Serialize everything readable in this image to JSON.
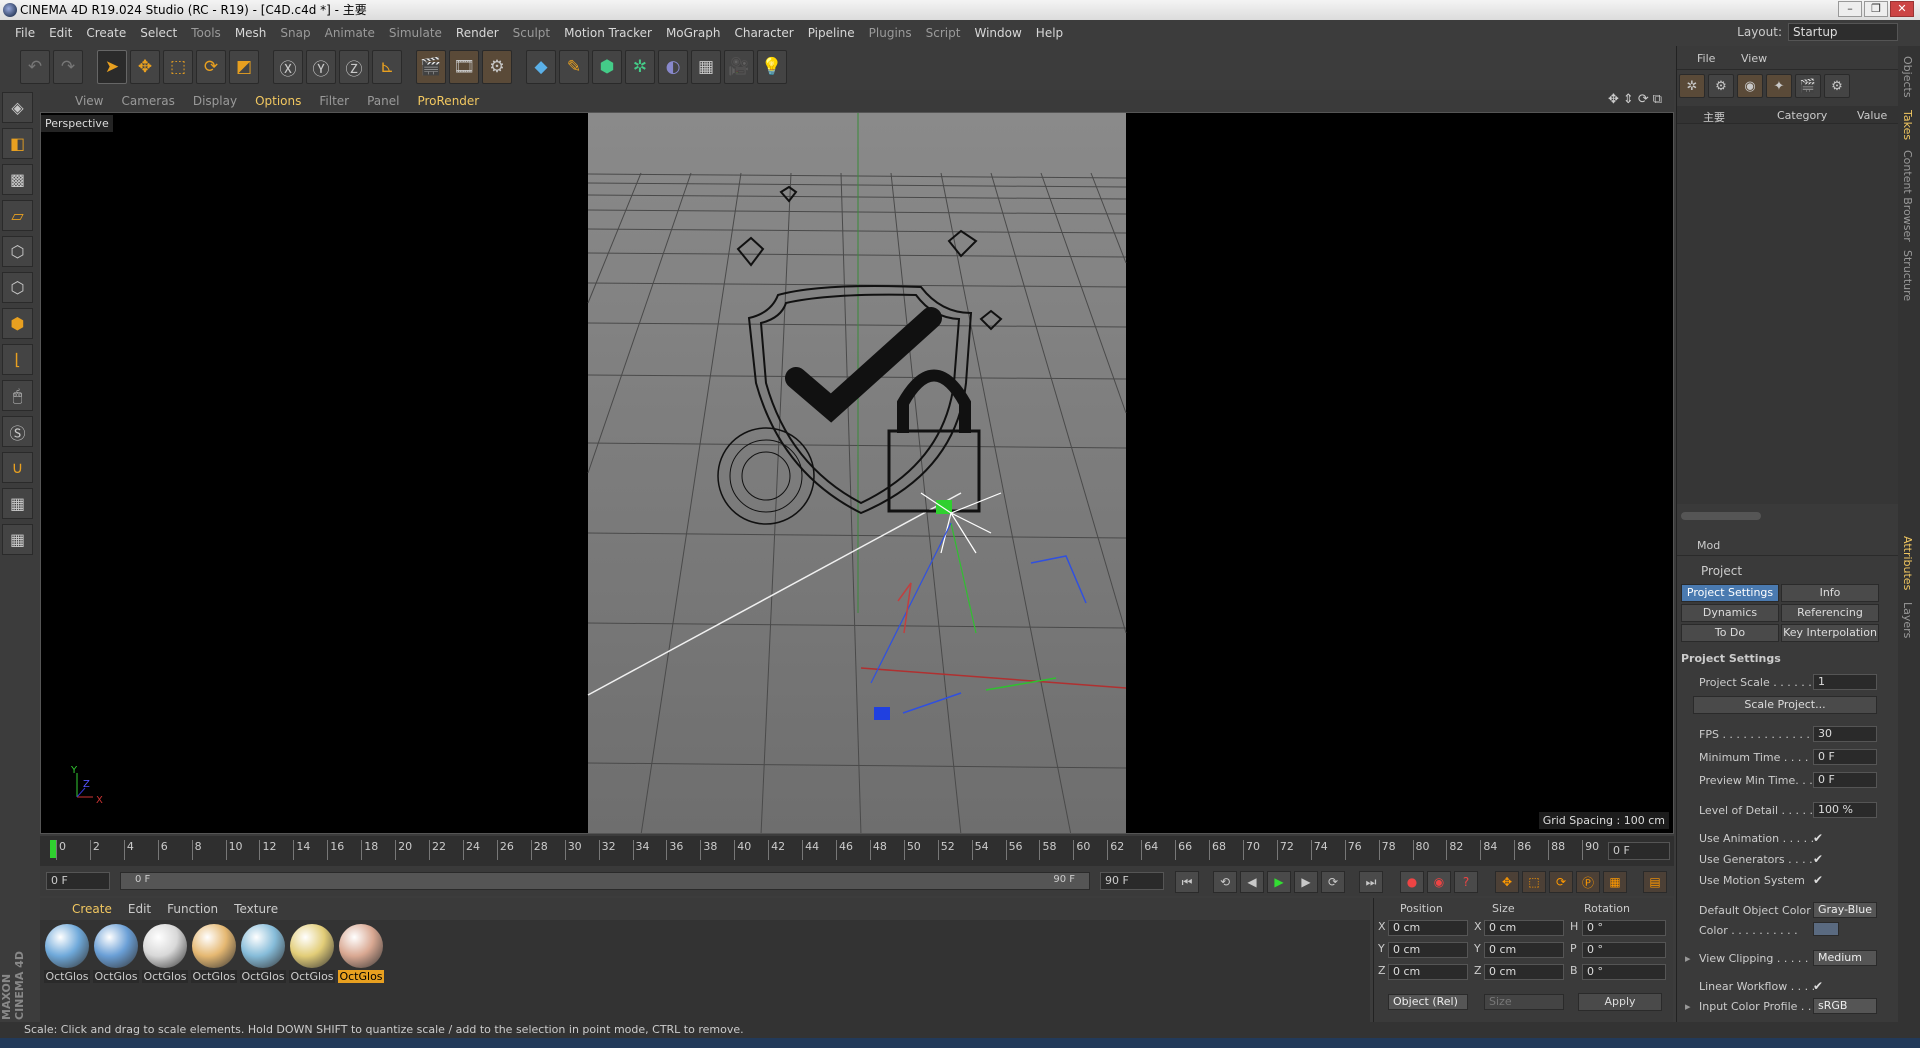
{
  "window": {
    "title": "CINEMA 4D R19.024 Studio (RC - R19) - [C4D.c4d *] - 主要"
  },
  "menu": [
    "File",
    "Edit",
    "Create",
    "Select",
    "Tools",
    "Mesh",
    "Snap",
    "Animate",
    "Simulate",
    "Render",
    "Sculpt",
    "Motion Tracker",
    "MoGraph",
    "Character",
    "Pipeline",
    "Plugins",
    "Script",
    "Window",
    "Help"
  ],
  "layout": {
    "label": "Layout:",
    "value": "Startup"
  },
  "viewport": {
    "menu": [
      "View",
      "Cameras",
      "Display",
      "Options",
      "Filter",
      "Panel",
      "ProRender"
    ],
    "active_menu": "Options",
    "label": "Perspective",
    "grid_spacing": "Grid Spacing : 100 cm"
  },
  "timeline": {
    "ticks": [
      "0",
      "2",
      "4",
      "6",
      "8",
      "10",
      "12",
      "14",
      "16",
      "18",
      "20",
      "22",
      "24",
      "26",
      "28",
      "30",
      "32",
      "34",
      "36",
      "38",
      "40",
      "42",
      "44",
      "46",
      "48",
      "50",
      "52",
      "54",
      "56",
      "58",
      "60",
      "62",
      "64",
      "66",
      "68",
      "70",
      "72",
      "74",
      "76",
      "78",
      "80",
      "82",
      "84",
      "86",
      "88",
      "90"
    ],
    "current_frame": "0 F"
  },
  "controls": {
    "start": "0 F",
    "slider_left": "0 F",
    "slider_right": "90 F",
    "end": "90 F"
  },
  "materials": {
    "menu": [
      "Create",
      "Edit",
      "Function",
      "Texture"
    ],
    "active_menu": "Create",
    "items": [
      {
        "name": "OctGlos",
        "color": "#6fa9da"
      },
      {
        "name": "OctGlos",
        "color": "#6a9fd6"
      },
      {
        "name": "OctGlos",
        "color": "#d8d8d8"
      },
      {
        "name": "OctGlos",
        "color": "#e5b872"
      },
      {
        "name": "OctGlos",
        "color": "#86bcd9"
      },
      {
        "name": "OctGlos",
        "color": "#e2cd78"
      },
      {
        "name": "OctGlos",
        "color": "#d9a892"
      }
    ],
    "selected_index": 6
  },
  "coords": {
    "headers": {
      "position": "Position",
      "size": "Size",
      "rotation": "Rotation"
    },
    "rows": [
      {
        "axis": "X",
        "pos": "0 cm",
        "saxis": "X",
        "size": "0 cm",
        "raxis": "H",
        "rot": "0 °"
      },
      {
        "axis": "Y",
        "pos": "0 cm",
        "saxis": "Y",
        "size": "0 cm",
        "raxis": "P",
        "rot": "0 °"
      },
      {
        "axis": "Z",
        "pos": "0 cm",
        "saxis": "Z",
        "size": "0 cm",
        "raxis": "B",
        "rot": "0 °"
      }
    ],
    "mode": "Object (Rel)",
    "size_mode": "Size",
    "apply": "Apply"
  },
  "status": "Scale: Click and drag to scale elements. Hold DOWN SHIFT to quantize scale / add to the selection in point mode, CTRL to remove.",
  "brand": "MAXON CINEMA 4D",
  "objects": {
    "menu": [
      "File",
      "View"
    ],
    "col_name": "主要",
    "col_category": "Category",
    "col_value": "Value"
  },
  "attributes": {
    "mode_label": "Mod",
    "title": "Project",
    "tabs": [
      "Project Settings",
      "Info",
      "Dynamics",
      "Referencing",
      "To Do",
      "Key Interpolation"
    ],
    "section": "Project Settings",
    "scale_label": "Project Scale . . . . . .",
    "scale_value": "1",
    "scale_button": "Scale Project...",
    "fps_label": "FPS . . . . . . . . . . . . .",
    "fps": "30",
    "min_time_label": "Minimum Time . . . .",
    "min_time": "0 F",
    "prev_min_label": "Preview Min Time. . .",
    "prev_min": "0 F",
    "lod_label": "Level of Detail . . . . .",
    "lod": "100 %",
    "use_animation": "Use Animation . . . . .",
    "use_generators": "Use Generators . . . .",
    "use_motion": "Use Motion System",
    "check": "✔",
    "default_color_label": "Default Object Color",
    "default_color": "Gray-Blue",
    "color_label": "Color . . . . . . . . . .",
    "view_clipping_label": "View Clipping . . . . .",
    "view_clipping": "Medium",
    "linear_workflow": "Linear Workflow . . . .",
    "input_profile_label": "Input Color Profile . .",
    "input_profile": "sRGB"
  },
  "side_tabs": [
    "Objects",
    "Takes",
    "Content Browser",
    "Structure",
    "Attributes",
    "Layers"
  ],
  "viewport_gizmo": {
    "x": "X",
    "y": "Y",
    "z": "Z"
  }
}
